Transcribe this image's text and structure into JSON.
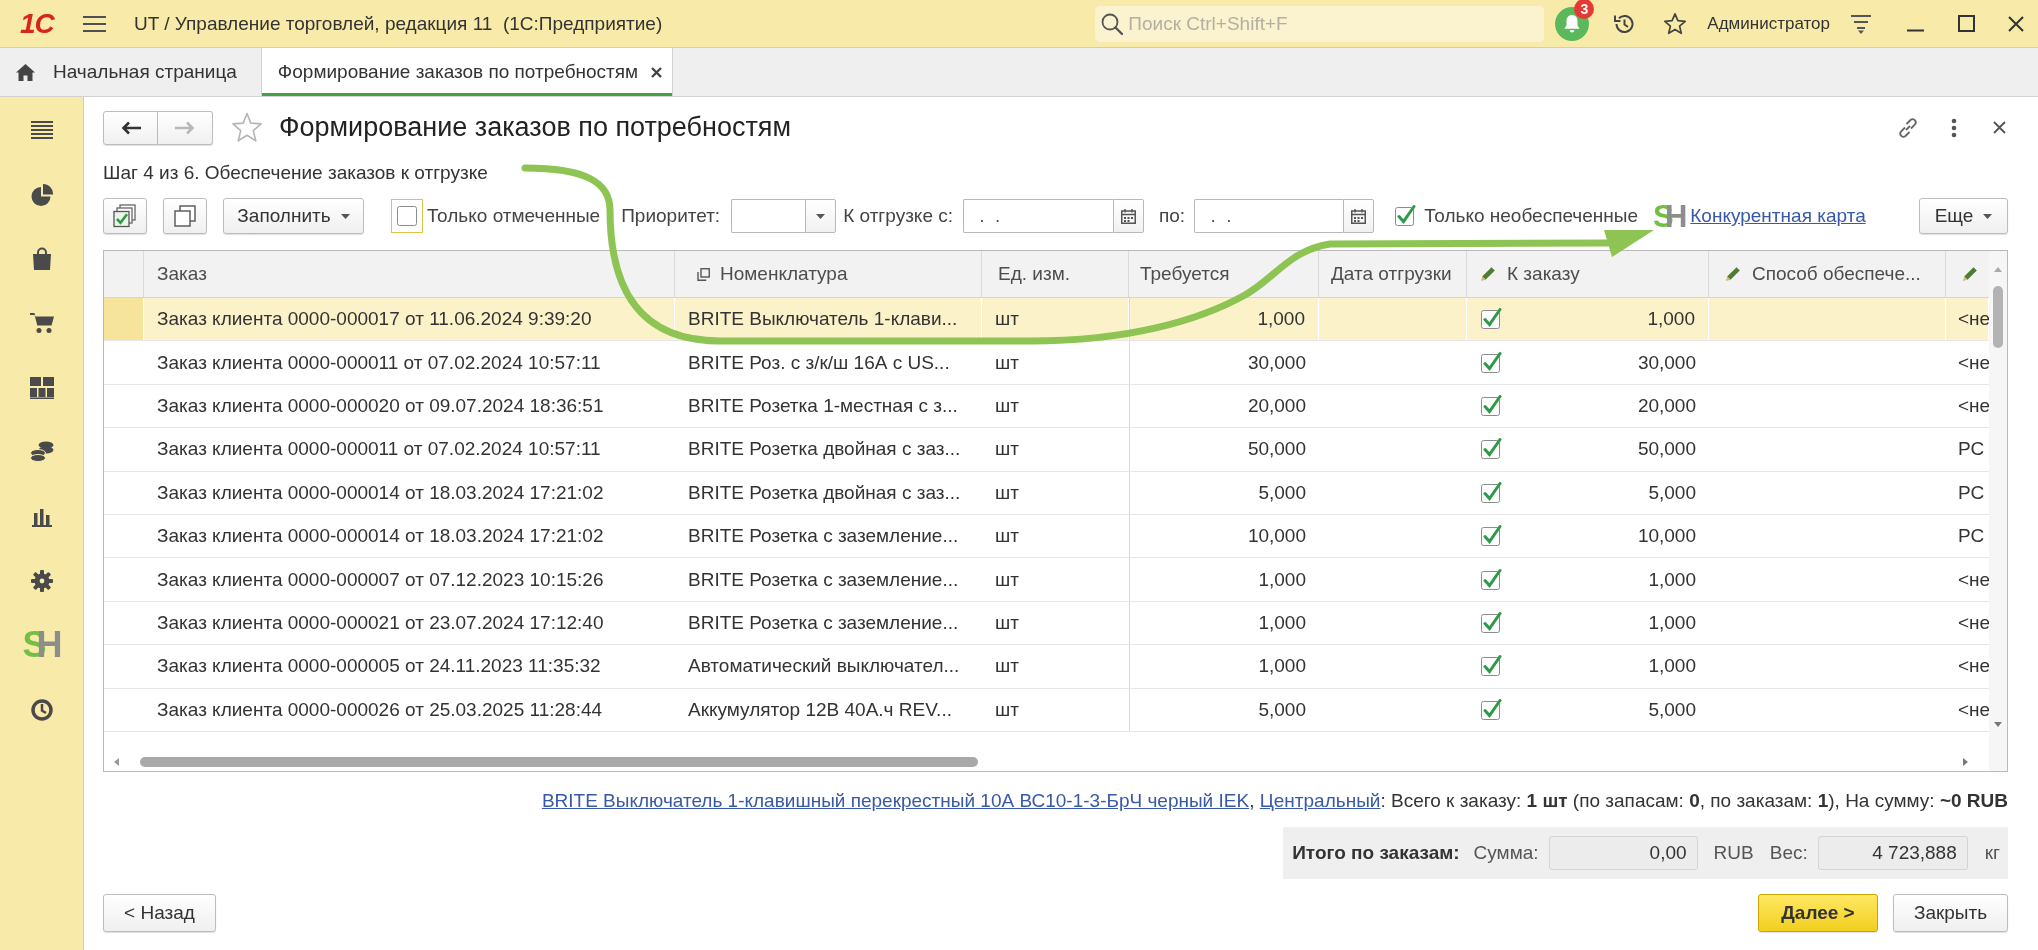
{
  "window": {
    "logo": "1С",
    "title": "UT / Управление торговлей, редакция 11  (1С:Предприятие)",
    "search": {
      "placeholder": "Поиск Ctrl+Shift+F"
    },
    "notifications": "3",
    "user": "Администратор"
  },
  "tabs": [
    {
      "kind": "home",
      "label": "Начальная страница",
      "selected": false
    },
    {
      "kind": "document",
      "label": "Формирование заказов по потребностям",
      "selected": true
    }
  ],
  "sidebar": {
    "logo": "SH"
  },
  "form": {
    "navigation": [
      {
        "kind": "back",
        "disabled": false
      },
      {
        "kind": "forward",
        "disabled": true
      }
    ],
    "favorite": false,
    "title": "Формирование заказов по потребностям",
    "step": "Шаг 4 из 6. Обеспечение заказов к отгрузке"
  },
  "toolbar": {
    "fill_button": "Заполнить",
    "only_marked": {
      "label": "Только отмеченные",
      "checked": false,
      "focused": true
    },
    "priority": {
      "label": "Приоритет:"
    },
    "ship_from": {
      "label": "К отгрузке с:",
      "value": " .  ."
    },
    "ship_to": {
      "label": "по:",
      "value": " .  ."
    },
    "only_unsecured": {
      "label": "Только необеспеченные",
      "checked": true,
      "focused": false
    },
    "logo": "SH",
    "link": "Конкурентная карта",
    "more_button": "Еще"
  },
  "table": {
    "columns": [
      {
        "kind": "plain",
        "label": "Заказ"
      },
      {
        "kind": "reference",
        "label": "Номенклатура"
      },
      {
        "kind": "plain",
        "label": "Ед. изм."
      },
      {
        "kind": "plain",
        "label": "Требуется"
      },
      {
        "kind": "plain",
        "label": "Дата отгрузки"
      },
      {
        "kind": "editable",
        "label": "К заказу"
      },
      {
        "kind": "editable",
        "label": "Способ обеспече..."
      },
      {
        "kind": "editable"
      }
    ],
    "rows": [
      {
        "selected": true,
        "order": "Заказ клиента 0000-000017 от 11.06.2024 9:39:20",
        "item": "BRITE Выключатель 1-клави...",
        "unit": "шт",
        "required": "1,000",
        "ordered": true,
        "to_order": "1,000",
        "column_9": "<не"
      },
      {
        "selected": false,
        "order": "Заказ клиента 0000-000011 от 07.02.2024 10:57:11",
        "item": "BRITE Роз. с з/к/ш 16А с US...",
        "unit": "шт",
        "required": "30,000",
        "ordered": true,
        "to_order": "30,000",
        "column_9": "<не"
      },
      {
        "selected": false,
        "order": "Заказ клиента 0000-000020 от 09.07.2024 18:36:51",
        "item": "BRITE Розетка 1-местная с з...",
        "unit": "шт",
        "required": "20,000",
        "ordered": true,
        "to_order": "20,000",
        "column_9": "<не"
      },
      {
        "selected": false,
        "order": "Заказ клиента 0000-000011 от 07.02.2024 10:57:11",
        "item": "BRITE Розетка двойная с заз...",
        "unit": "шт",
        "required": "50,000",
        "ordered": true,
        "to_order": "50,000",
        "column_9": "РС"
      },
      {
        "selected": false,
        "order": "Заказ клиента 0000-000014 от 18.03.2024 17:21:02",
        "item": "BRITE Розетка двойная с заз...",
        "unit": "шт",
        "required": "5,000",
        "ordered": true,
        "to_order": "5,000",
        "column_9": "РС"
      },
      {
        "selected": false,
        "order": "Заказ клиента 0000-000014 от 18.03.2024 17:21:02",
        "item": "BRITE Розетка с заземление...",
        "unit": "шт",
        "required": "10,000",
        "ordered": true,
        "to_order": "10,000",
        "column_9": "РС"
      },
      {
        "selected": false,
        "order": "Заказ клиента 0000-000007 от 07.12.2023 10:15:26",
        "item": "BRITE Розетка с заземление...",
        "unit": "шт",
        "required": "1,000",
        "ordered": true,
        "to_order": "1,000",
        "column_9": "<не"
      },
      {
        "selected": false,
        "order": "Заказ клиента 0000-000021 от 23.07.2024 17:12:40",
        "item": "BRITE Розетка с заземление...",
        "unit": "шт",
        "required": "1,000",
        "ordered": true,
        "to_order": "1,000",
        "column_9": "<не"
      },
      {
        "selected": false,
        "order": "Заказ клиента 0000-000005 от 24.11.2023 11:35:32",
        "item": "Автоматический выключател...",
        "unit": "шт",
        "required": "1,000",
        "ordered": true,
        "to_order": "1,000",
        "column_9": "<не"
      },
      {
        "selected": false,
        "order": "Заказ клиента 0000-000026 от 25.03.2025 11:28:44",
        "item": "Аккумулятор 12В 40А.ч REV...",
        "unit": "шт",
        "required": "5,000",
        "ordered": true,
        "to_order": "5,000",
        "column_9": "<не"
      }
    ]
  },
  "selection_info": [
    {
      "kind": "link",
      "text": "BRITE Выключатель 1-клавишный перекрестный 10А ВС10-1-3-БрЧ черный IEK"
    },
    {
      "kind": "text",
      "text": ", "
    },
    {
      "kind": "link",
      "text": "Центральный"
    },
    {
      "kind": "text",
      "text": ": Всего к заказу: **1 шт** (по запасам: **0**, по заказам: **1**), На сумму: **~0 RUB**"
    }
  ],
  "totals": {
    "label": "Итого по заказам:",
    "sum_label": "Сумма:",
    "sum": "0,00",
    "currency": "RUB",
    "weight_label": "Вес:",
    "weight": "4 723,888",
    "weight_unit": "кг"
  },
  "buttons": [
    {
      "kind": "back",
      "label": "< Назад"
    },
    {
      "kind": "primary",
      "label": "Далее >"
    },
    {
      "kind": "secondary",
      "label": "Закрыть"
    }
  ]
}
